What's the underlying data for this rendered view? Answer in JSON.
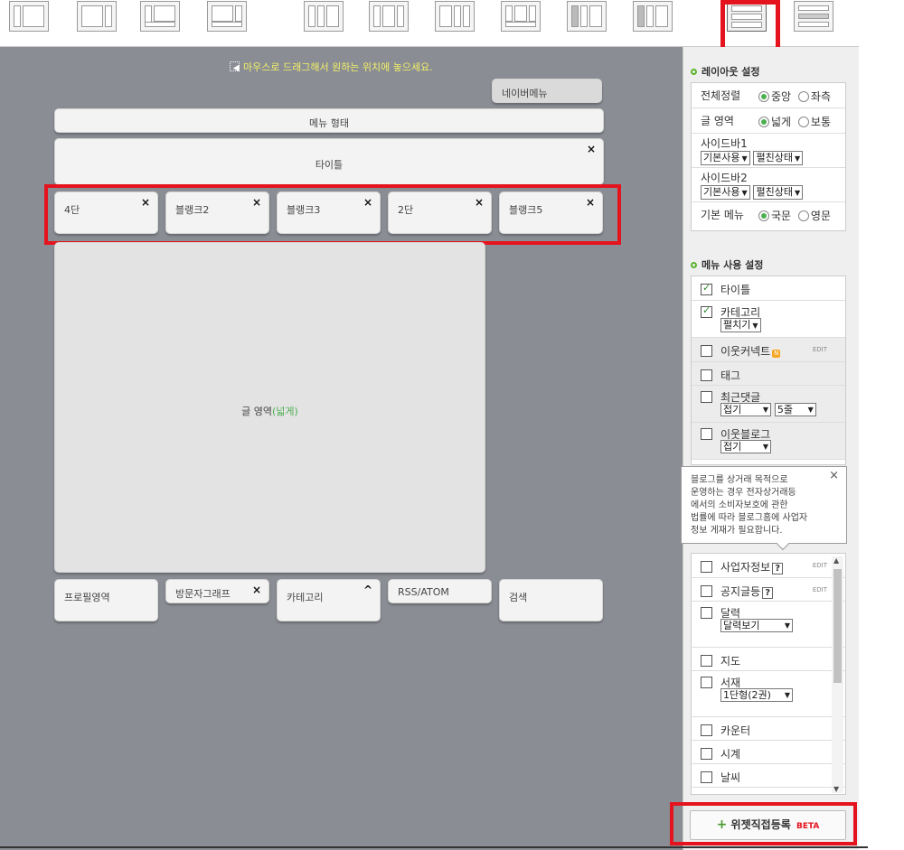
{
  "layout_icons": [
    {
      "name": "layout-option-1"
    },
    {
      "name": "layout-option-2"
    },
    {
      "name": "layout-option-3"
    },
    {
      "name": "layout-option-4"
    },
    {
      "name": "layout-option-5"
    },
    {
      "name": "layout-option-6"
    },
    {
      "name": "layout-option-7"
    },
    {
      "name": "layout-option-8"
    },
    {
      "name": "layout-option-9"
    },
    {
      "name": "layout-option-10"
    },
    {
      "name": "layout-option-11"
    },
    {
      "name": "layout-option-12"
    }
  ],
  "canvas": {
    "hint": "마우스로 드래그해서 원하는 위치에 놓으세요.",
    "nav_menu": "네이버메뉴",
    "menu_type": "메뉴 형태",
    "title": "타이틀",
    "row_blocks": [
      "4단",
      "블랭크2",
      "블랭크3",
      "2단",
      "블랭크5"
    ],
    "content_area": "글 영역",
    "content_area_mode": "(넓게)",
    "bottom_blocks": [
      "프로필영역",
      "방문자그래프",
      "카테고리",
      "RSS/ATOM",
      "검색"
    ],
    "close_glyph": "×",
    "caret_glyph": "^"
  },
  "layout_settings": {
    "title": "레이아웃 설정",
    "align": {
      "label": "전체정렬",
      "options": [
        "중앙",
        "좌측"
      ],
      "selected": 0
    },
    "content_width": {
      "label": "글 영역",
      "options": [
        "넓게",
        "보통"
      ],
      "selected": 0
    },
    "sidebar1": {
      "label": "사이드바1",
      "select1": "기본사용",
      "select2": "펼친상태"
    },
    "sidebar2": {
      "label": "사이드바2",
      "select1": "기본사용",
      "select2": "펼친상태"
    },
    "basic_menu": {
      "label": "기본 메뉴",
      "options": [
        "국문",
        "영문"
      ],
      "selected": 0
    }
  },
  "menu_settings": {
    "title": "메뉴 사용 설정",
    "items": [
      {
        "label": "타이틀",
        "checked": true
      },
      {
        "label": "카테고리",
        "checked": true,
        "select": "펼치기"
      },
      {
        "label": "이웃커넥트",
        "checked": false,
        "badge": "N",
        "edit": "EDIT"
      },
      {
        "label": "태그",
        "checked": false
      },
      {
        "label": "최근댓글",
        "checked": false,
        "select": "접기",
        "select2": "5줄"
      },
      {
        "label": "이웃블로그",
        "checked": false,
        "select": "접기"
      }
    ],
    "items2": [
      {
        "label": "사업자정보",
        "checked": false,
        "q": "?",
        "edit": "EDIT"
      },
      {
        "label": "공지글등",
        "checked": false,
        "q": "?",
        "edit": "EDIT"
      },
      {
        "label": "달력",
        "checked": false,
        "select": "달력보기"
      },
      {
        "label": "지도",
        "checked": false
      },
      {
        "label": "서재",
        "checked": false,
        "select": "1단형(2권)"
      },
      {
        "label": "카운터",
        "checked": false
      },
      {
        "label": "시계",
        "checked": false
      },
      {
        "label": "날씨",
        "checked": false
      }
    ]
  },
  "tooltip": {
    "lines": [
      "블로그를 상거래 목적으로",
      "운영하는 경우 전자상거래등",
      "에서의 소비자보호에 관한",
      "법률에 따라 블로그홈에 사업자",
      "정보 게재가 필요합니다."
    ],
    "close": "×"
  },
  "widget_button": {
    "plus": "+",
    "label": "위젯직접등록",
    "beta": "BETA"
  },
  "colors": {
    "accent_red": "#e5131d",
    "canvas_bg": "#8a8d94",
    "hint_yellow": "#f2f066",
    "green": "#4caf50"
  }
}
